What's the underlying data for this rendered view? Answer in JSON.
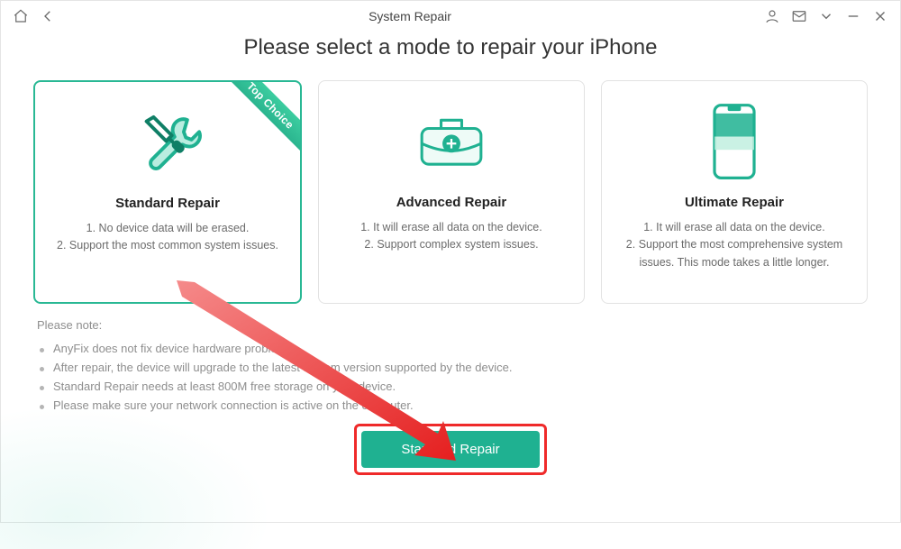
{
  "titlebar": {
    "title": "System Repair"
  },
  "heading": "Please select a mode to repair your iPhone",
  "ribbon_text": "Top Choice",
  "cards": [
    {
      "title": "Standard Repair",
      "lines": [
        "1. No device data will be erased.",
        "2. Support the most common system issues."
      ]
    },
    {
      "title": "Advanced Repair",
      "lines": [
        "1. It will erase all data on the device.",
        "2. Support complex system issues."
      ]
    },
    {
      "title": "Ultimate Repair",
      "lines": [
        "1. It will erase all data on the device.",
        "2. Support the most comprehensive system issues. This mode takes a little longer."
      ]
    }
  ],
  "note": {
    "title": "Please note:",
    "items": [
      "AnyFix does not fix device hardware problems.",
      "After repair, the device will upgrade to the latest system version supported by the device.",
      "Standard Repair needs at least 800M free storage on your device.",
      "Please make sure your network connection is active on the computer."
    ]
  },
  "primary_button": "Standard Repair",
  "colors": {
    "accent": "#1fb191"
  }
}
